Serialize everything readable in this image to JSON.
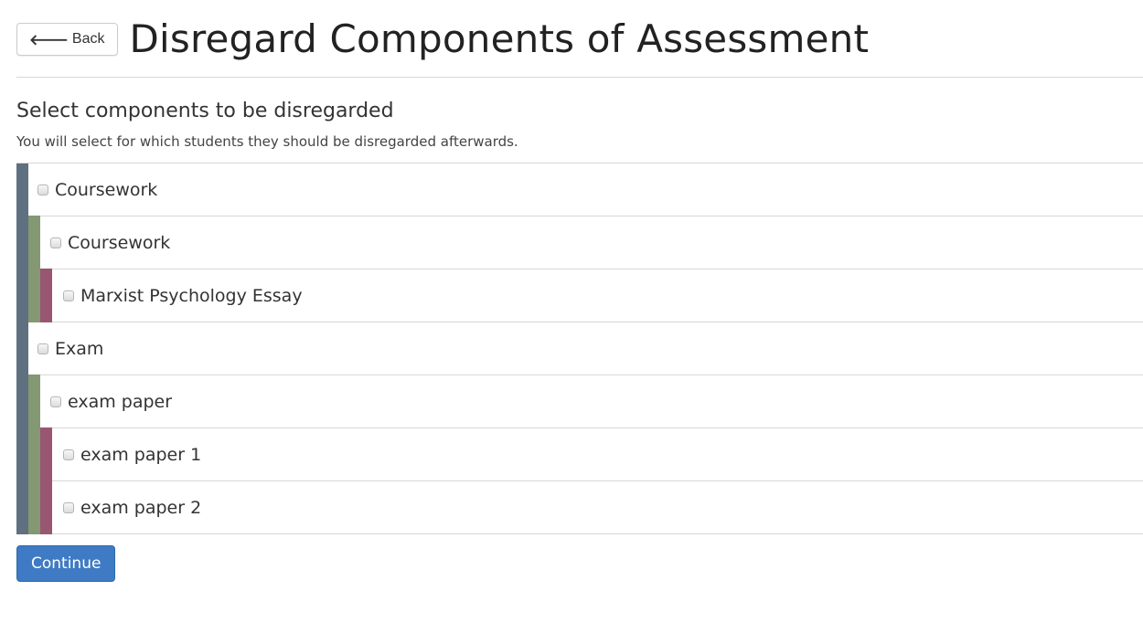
{
  "header": {
    "back_label": "Back",
    "back_icon": "arrow-left-icon",
    "title": "Disregard Components of Assessment"
  },
  "section": {
    "subtitle": "Select components to be disregarded",
    "help_text": "You will select for which students they should be disregarded afterwards."
  },
  "colors": {
    "level1_bar": "#5f7080",
    "level2_bar": "#839873",
    "level3_bar": "#995673",
    "primary_button": "#3f7bc4"
  },
  "components": [
    {
      "label": "Coursework",
      "level": 1,
      "checked": false
    },
    {
      "label": "Coursework",
      "level": 2,
      "checked": false
    },
    {
      "label": "Marxist Psychology Essay",
      "level": 3,
      "checked": false
    },
    {
      "label": "Exam",
      "level": 1,
      "checked": false
    },
    {
      "label": "exam paper",
      "level": 2,
      "checked": false
    },
    {
      "label": "exam paper 1",
      "level": 3,
      "checked": false
    },
    {
      "label": "exam paper 2",
      "level": 3,
      "checked": false
    }
  ],
  "actions": {
    "continue_label": "Continue"
  }
}
